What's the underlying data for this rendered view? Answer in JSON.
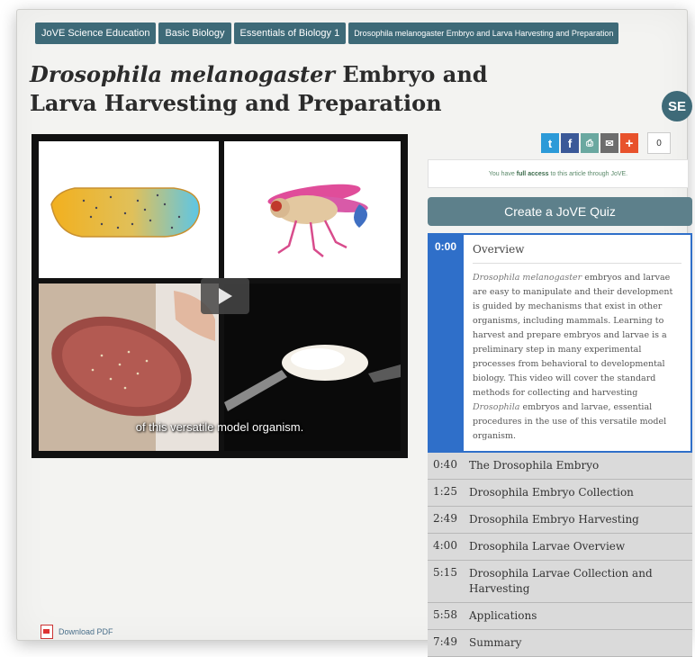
{
  "breadcrumbs": [
    "JoVE Science Education",
    "Basic Biology",
    "Essentials of Biology 1",
    "Drosophila melanogaster Embryo and Larva Harvesting and Preparation"
  ],
  "title": {
    "italic": "Drosophila melanogaster",
    "rest": " Embryo and Larva Harvesting and Preparation"
  },
  "avatar": "SE",
  "share": {
    "twitter": "t",
    "facebook": "f",
    "print": "⎙",
    "email": "✉",
    "plus": "+",
    "count": "0"
  },
  "access": {
    "prefix": "You have",
    "bold": "full access",
    "suffix": "to this article through JoVE."
  },
  "quiz_label": "Create a JoVE Quiz",
  "video": {
    "caption": "of this versatile model organism."
  },
  "active_chapter": {
    "time": "0:00",
    "title": "Overview",
    "desc_italic1": "Drosophila melanogaster",
    "desc_part1": " embryos and larvae are easy to manipulate and their development is guided by mechanisms that exist in other organisms, including mammals. Learning to harvest and prepare embryos and larvae is a preliminary step in many experimental processes from behavioral to developmental biology. This video will cover the standard methods for collecting and harvesting ",
    "desc_italic2": "Drosophila",
    "desc_part2": " embryos and larvae, essential procedures in the use of this versatile model organism."
  },
  "chapters": [
    {
      "time": "0:40",
      "title": "The Drosophila Embryo"
    },
    {
      "time": "1:25",
      "title": "Drosophila Embryo Collection"
    },
    {
      "time": "2:49",
      "title": "Drosophila Embryo Harvesting"
    },
    {
      "time": "4:00",
      "title": "Drosophila Larvae Overview"
    },
    {
      "time": "5:15",
      "title": "Drosophila Larvae Collection and Harvesting"
    },
    {
      "time": "5:58",
      "title": "Applications"
    },
    {
      "time": "7:49",
      "title": "Summary"
    }
  ],
  "pdf_label": "Download PDF",
  "colors": {
    "breadcrumb": "#3e6a78",
    "active_chapter": "#2f6fc9",
    "quiz_button": "#5d808b"
  }
}
